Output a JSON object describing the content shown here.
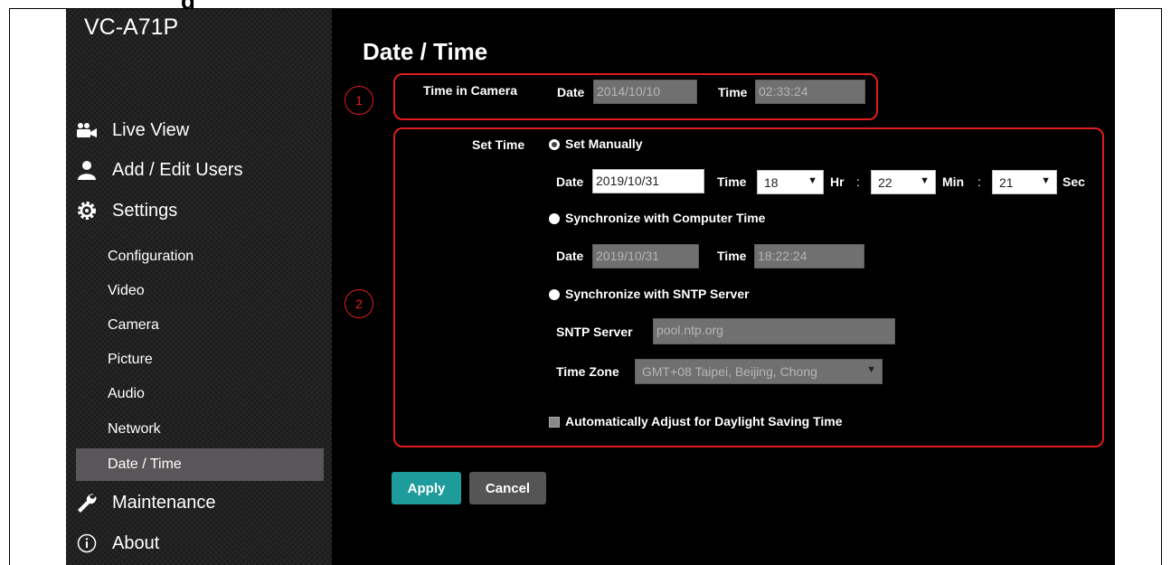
{
  "app": {
    "brand": "VC-A71P",
    "heading_fragment": "g"
  },
  "sidebar": {
    "live_view": "Live View",
    "add_edit_users": "Add / Edit Users",
    "settings": "Settings",
    "settings_items": [
      "Configuration",
      "Video",
      "Camera",
      "Picture",
      "Audio",
      "Network",
      "Date / Time"
    ],
    "active_item": "Date / Time",
    "maintenance": "Maintenance",
    "about": "About"
  },
  "main": {
    "title": "Date / Time",
    "callouts": [
      "1",
      "2"
    ],
    "time_in_camera": {
      "label": "Time in Camera",
      "date_label": "Date",
      "date_value": "2014/10/10",
      "time_label": "Time",
      "time_value": "02:33:24"
    },
    "set_time": {
      "label": "Set Time",
      "manual": {
        "label": "Set Manually",
        "selected": true,
        "date_label": "Date",
        "date_value": "2019/10/31",
        "time_label": "Time",
        "hour": "18",
        "hr_label": "Hr",
        "colon": ":",
        "minute": "22",
        "min_label": "Min",
        "second": "21",
        "sec_label": "Sec"
      },
      "sync_computer": {
        "label": "Synchronize with Computer Time",
        "date_label": "Date",
        "date_value": "2019/10/31",
        "time_label": "Time",
        "time_value": "18:22:24"
      },
      "sync_sntp": {
        "label": "Synchronize with SNTP Server",
        "server_label": "SNTP Server",
        "server_value": "pool.ntp.org",
        "timezone_label": "Time Zone",
        "timezone_value": "GMT+08 Taipei, Beijing, Chong"
      },
      "dst_label": "Automatically Adjust for Daylight Saving Time"
    },
    "buttons": {
      "apply": "Apply",
      "cancel": "Cancel"
    }
  },
  "colors": {
    "accent": "#1e9b9b",
    "callout": "#e01c1c",
    "active_nav": "#5a5558"
  }
}
